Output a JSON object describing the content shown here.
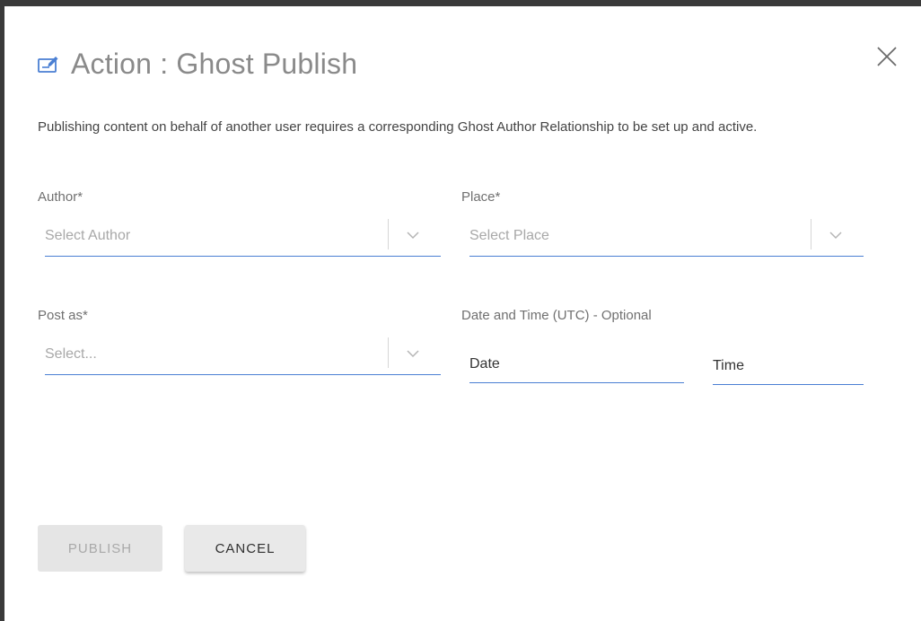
{
  "dialog": {
    "title": "Action : Ghost Publish",
    "description": "Publishing content on behalf of another user requires a corresponding Ghost Author Relationship to be set up and active.",
    "title_icon": "edit-note-icon",
    "close_icon": "close-icon"
  },
  "fields": {
    "author": {
      "label": "Author*",
      "placeholder": "Select Author"
    },
    "place": {
      "label": "Place*",
      "placeholder": "Select Place"
    },
    "post_as": {
      "label": "Post as*",
      "placeholder": "Select..."
    },
    "datetime": {
      "label": "Date and Time (UTC) - Optional",
      "date_value": "Date",
      "time_value": "Time"
    }
  },
  "buttons": {
    "publish": "PUBLISH",
    "cancel": "CANCEL"
  },
  "colors": {
    "accent": "#4a7fd3",
    "title": "#8a8a8a",
    "frame": "#3a3a3a"
  }
}
